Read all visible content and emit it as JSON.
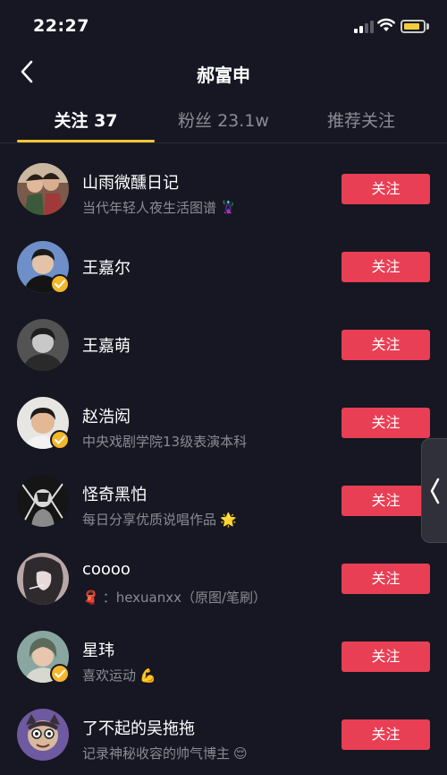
{
  "status_bar": {
    "time": "22:27"
  },
  "nav": {
    "title": "郝富申"
  },
  "tabs": [
    {
      "label": "关注 37",
      "active": true
    },
    {
      "label": "粉丝 23.1w",
      "active": false
    },
    {
      "label": "推荐关注",
      "active": false
    }
  ],
  "users": [
    {
      "name": "山雨微醺日记",
      "bio": "当代年轻人夜生活图谱",
      "bio_emoji": "🦹",
      "verified": false,
      "follow_label": "关注"
    },
    {
      "name": "王嘉尔",
      "bio": "",
      "verified": true,
      "follow_label": "关注"
    },
    {
      "name": "王嘉萌",
      "bio": "",
      "verified": false,
      "follow_label": "关注"
    },
    {
      "name": "赵浩闳",
      "bio": "中央戏剧学院13级表演本科",
      "verified": true,
      "follow_label": "关注"
    },
    {
      "name": "怪奇黑怕",
      "bio": "每日分享优质说唱作品",
      "bio_emoji": "🌟",
      "verified": false,
      "follow_label": "关注"
    },
    {
      "name": "coooo",
      "bio": "：hexuanxx（原图/笔刷）",
      "bio_emoji_prefix": "🧣",
      "verified": false,
      "follow_label": "关注"
    },
    {
      "name": "星玮",
      "bio": "喜欢运动",
      "bio_emoji": "💪",
      "verified": true,
      "follow_label": "关注"
    },
    {
      "name": "了不起的吴拖拖",
      "bio": "记录神秘收容的帅气博主",
      "bio_emoji": "😌",
      "verified": false,
      "follow_label": "关注"
    }
  ],
  "colors": {
    "background": "#161722",
    "accent": "#e83f54",
    "tab_indicator": "#f9c630",
    "verified_badge": "#f4b62a"
  }
}
